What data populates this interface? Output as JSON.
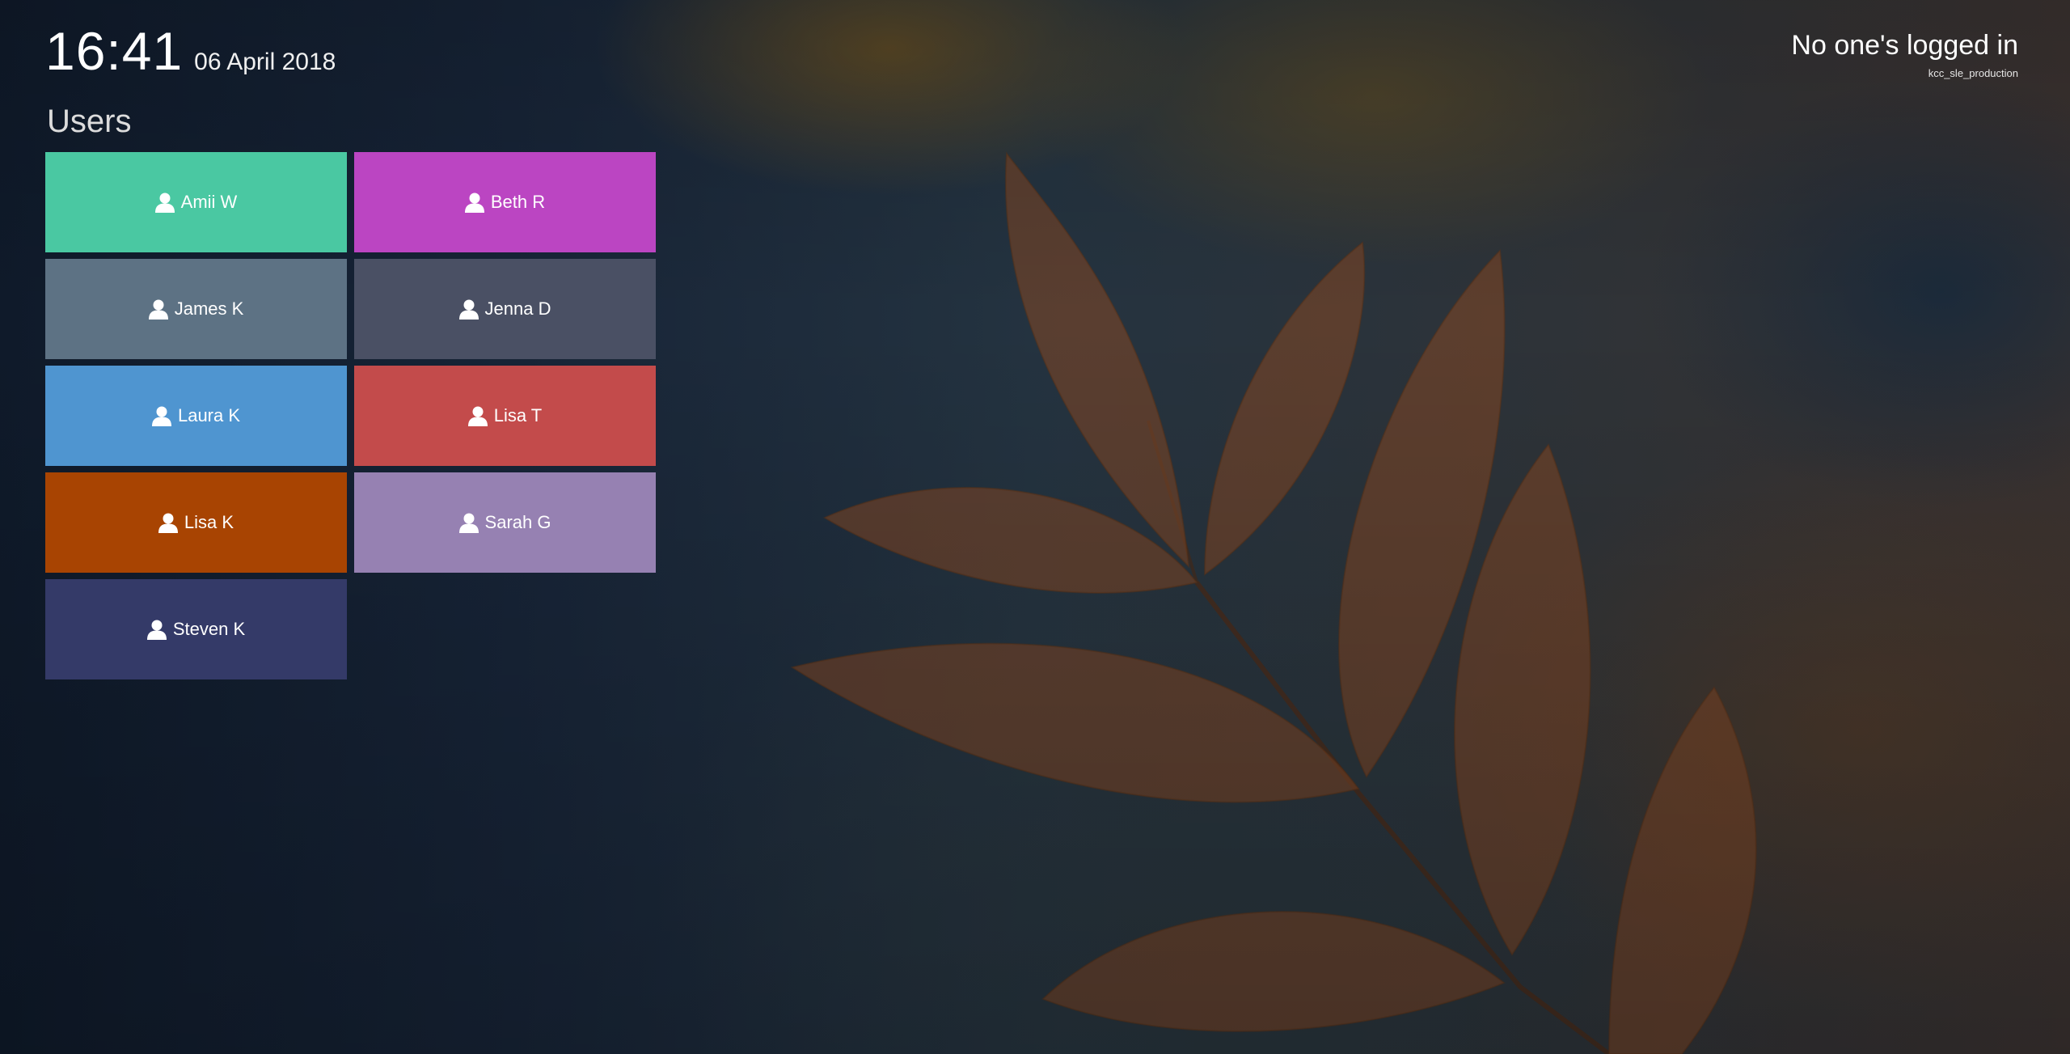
{
  "clock": {
    "time": "16:41",
    "date": "06 April 2018"
  },
  "status": {
    "text": "No one's logged in",
    "host": "kcc_sle_production"
  },
  "users_heading": "Users",
  "icons": {
    "user": "user-icon"
  },
  "users": [
    {
      "name": "Amii W",
      "color": "#4ac8a2"
    },
    {
      "name": "Beth R",
      "color": "#bb45c2"
    },
    {
      "name": "James K",
      "color": "#5d7284"
    },
    {
      "name": "Jenna D",
      "color": "#4a5064"
    },
    {
      "name": "Laura K",
      "color": "#4f95d0"
    },
    {
      "name": "Lisa T",
      "color": "#c34b4b"
    },
    {
      "name": "Lisa K",
      "color": "#a84402"
    },
    {
      "name": "Sarah G",
      "color": "#9681b2"
    },
    {
      "name": "Steven K",
      "color": "#343a68"
    }
  ]
}
